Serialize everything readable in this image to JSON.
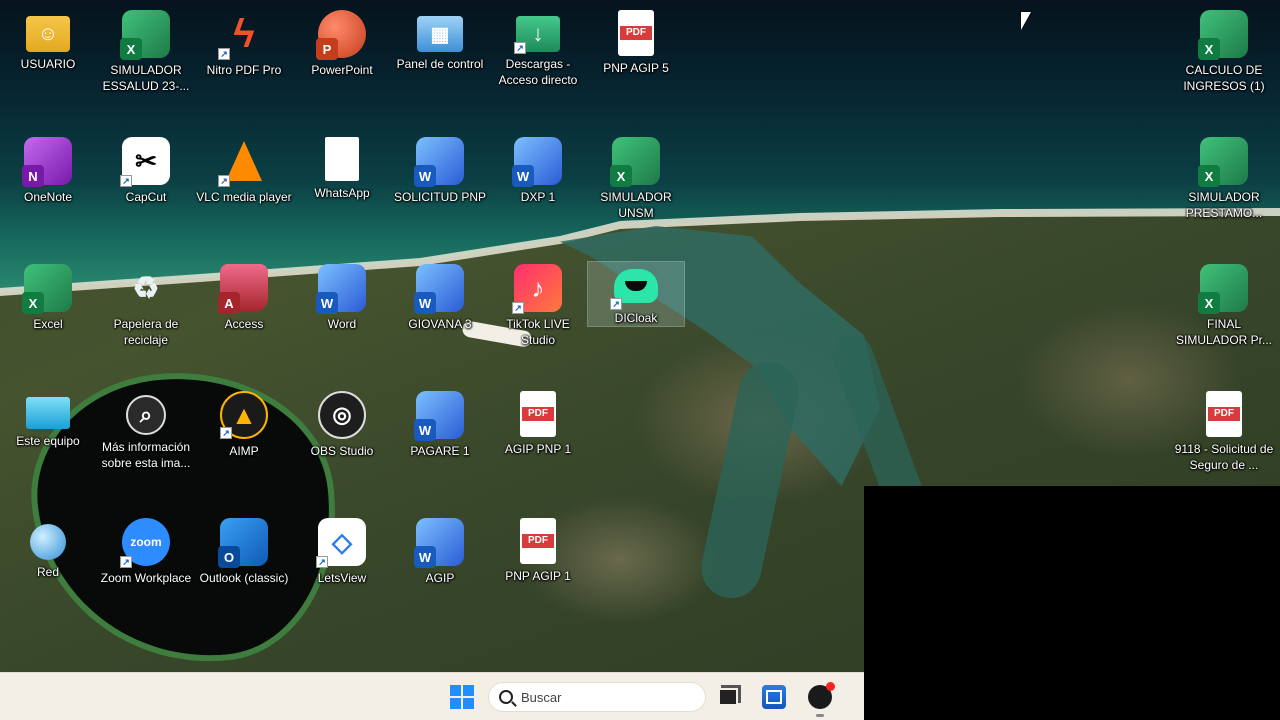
{
  "desktop": {
    "icons": [
      {
        "label": "USUARIO",
        "icon": "user-folder-icon"
      },
      {
        "label": "SIMULADOR ESSALUD 23-...",
        "icon": "excel-file-icon"
      },
      {
        "label": "Nitro PDF Pro",
        "icon": "nitro-pdf-icon"
      },
      {
        "label": "PowerPoint",
        "icon": "powerpoint-icon"
      },
      {
        "label": "Panel de control",
        "icon": "control-panel-icon"
      },
      {
        "label": "Descargas - Acceso directo",
        "icon": "downloads-folder-icon"
      },
      {
        "label": "PNP AGIP 5",
        "icon": "pdf-file-icon"
      },
      {
        "label": "CALCULO DE INGRESOS (1)",
        "icon": "excel-file-icon"
      },
      {
        "label": "OneNote",
        "icon": "onenote-icon"
      },
      {
        "label": "CapCut",
        "icon": "capcut-icon"
      },
      {
        "label": "VLC media player",
        "icon": "vlc-icon"
      },
      {
        "label": "WhatsApp",
        "icon": "blank-file-icon"
      },
      {
        "label": "SOLICITUD PNP",
        "icon": "word-file-icon"
      },
      {
        "label": "DXP 1",
        "icon": "word-file-icon"
      },
      {
        "label": "SIMULADOR UNSM",
        "icon": "excel-file-icon"
      },
      {
        "label": "SIMULADOR PRESTAMO...",
        "icon": "excel-file-icon"
      },
      {
        "label": "Excel",
        "icon": "excel-icon"
      },
      {
        "label": "Papelera de reciclaje",
        "icon": "recycle-bin-icon"
      },
      {
        "label": "Access",
        "icon": "access-icon"
      },
      {
        "label": "Word",
        "icon": "word-icon"
      },
      {
        "label": "GIOVANA 3",
        "icon": "word-file-icon"
      },
      {
        "label": "TikTok LIVE Studio",
        "icon": "tiktok-icon"
      },
      {
        "label": "DICloak",
        "icon": "dicloak-icon"
      },
      {
        "label": "FINAL SIMULADOR Pr...",
        "icon": "excel-file-icon"
      },
      {
        "label": "Este equipo",
        "icon": "this-pc-icon"
      },
      {
        "label": "Más información sobre esta ima...",
        "icon": "info-icon"
      },
      {
        "label": "AIMP",
        "icon": "aimp-icon"
      },
      {
        "label": "OBS Studio",
        "icon": "obs-icon"
      },
      {
        "label": "PAGARE 1",
        "icon": "word-file-icon"
      },
      {
        "label": "AGIP PNP 1",
        "icon": "pdf-file-icon"
      },
      {
        "label": "9118 - Solicitud de Seguro de ...",
        "icon": "pdf-file-icon"
      },
      {
        "label": "Red",
        "icon": "network-icon"
      },
      {
        "label": "Zoom Workplace",
        "icon": "zoom-icon"
      },
      {
        "label": "Outlook (classic)",
        "icon": "outlook-icon"
      },
      {
        "label": "LetsView",
        "icon": "letsview-icon"
      },
      {
        "label": "AGIP",
        "icon": "word-file-icon"
      },
      {
        "label": "PNP AGIP 1",
        "icon": "pdf-file-icon"
      }
    ],
    "selected_icon": "DICloak"
  },
  "taskbar": {
    "search_placeholder": "Buscar",
    "apps": [
      "start-icon",
      "task-view-icon",
      "microsoft-store-icon",
      "app-with-notification-icon"
    ]
  },
  "colors": {
    "taskbar": "#f3efe6",
    "start_accent": "#1f8fff",
    "notification_dot": "#ff2020"
  }
}
